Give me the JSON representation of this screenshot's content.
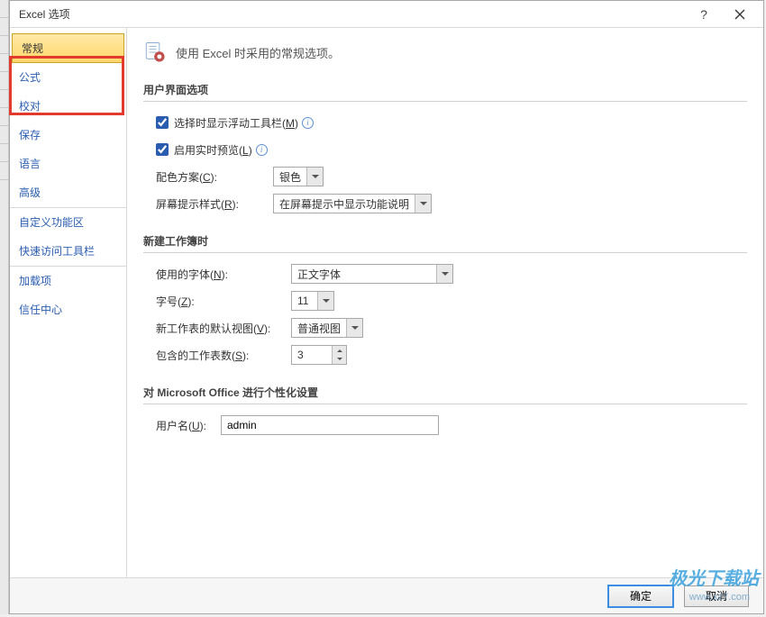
{
  "window": {
    "title": "Excel 选项"
  },
  "sidebar": {
    "items": [
      {
        "label": "常规"
      },
      {
        "label": "公式"
      },
      {
        "label": "校对"
      },
      {
        "label": "保存"
      },
      {
        "label": "语言"
      },
      {
        "label": "高级"
      },
      {
        "label": "自定义功能区"
      },
      {
        "label": "快速访问工具栏"
      },
      {
        "label": "加载项"
      },
      {
        "label": "信任中心"
      }
    ]
  },
  "main": {
    "subtitle": "使用 Excel 时采用的常规选项。",
    "section_ui": {
      "title": "用户界面选项",
      "show_floating_label_pre": "选择时显示浮动工具栏(",
      "show_floating_key": "M",
      "enable_preview_label_pre": "启用实时预览(",
      "enable_preview_key": "L",
      "color_scheme_label_pre": "配色方案(",
      "color_scheme_key": "C",
      "color_scheme_value": "银色",
      "tooltip_style_label_pre": "屏幕提示样式(",
      "tooltip_style_key": "R",
      "tooltip_style_value": "在屏幕提示中显示功能说明"
    },
    "section_new": {
      "title": "新建工作簿时",
      "font_label_pre": "使用的字体(",
      "font_key": "N",
      "font_value": "正文字体",
      "size_label_pre": "字号(",
      "size_key": "Z",
      "size_value": "11",
      "view_label_pre": "新工作表的默认视图(",
      "view_key": "V",
      "view_value": "普通视图",
      "sheets_label_pre": "包含的工作表数(",
      "sheets_key": "S",
      "sheets_value": "3"
    },
    "section_personal": {
      "title": "对 Microsoft Office 进行个性化设置",
      "username_label_pre": "用户名(",
      "username_key": "U",
      "username_value": "admin"
    }
  },
  "footer": {
    "ok": "确定",
    "cancel": "取消"
  },
  "watermark": {
    "main": "极光下载站",
    "sub": "www.xz7.com"
  },
  "label_post": "):"
}
